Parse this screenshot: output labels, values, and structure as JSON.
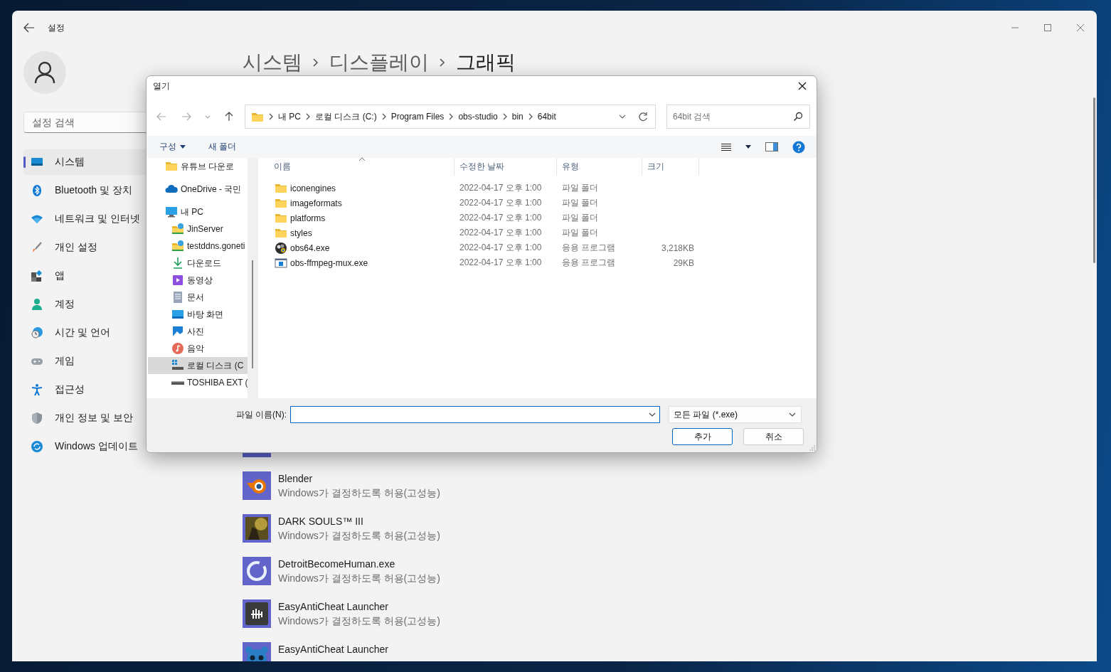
{
  "settings": {
    "title": "설정",
    "search": {
      "placeholder": "설정 검색"
    },
    "nav": [
      {
        "label": "시스템",
        "kind": "system",
        "selected": true
      },
      {
        "label": "Bluetooth 및 장치",
        "kind": "bluetooth",
        "selected": false
      },
      {
        "label": "네트워크 및 인터넷",
        "kind": "network",
        "selected": false
      },
      {
        "label": "개인 설정",
        "kind": "brush",
        "selected": false
      },
      {
        "label": "앱",
        "kind": "apps",
        "selected": false
      },
      {
        "label": "계정",
        "kind": "account",
        "selected": false
      },
      {
        "label": "시간 및 언어",
        "kind": "time",
        "selected": false
      },
      {
        "label": "게임",
        "kind": "game",
        "selected": false
      },
      {
        "label": "접근성",
        "kind": "accessibility",
        "selected": false
      },
      {
        "label": "개인 정보 및 보안",
        "kind": "shield",
        "selected": false
      },
      {
        "label": "Windows 업데이트",
        "kind": "update",
        "selected": false
      }
    ],
    "breadcrumb": [
      "시스템",
      "디스플레이",
      "그래픽"
    ],
    "apps": [
      {
        "kind": "generic"
      },
      {
        "kind": "blender",
        "name": "Blender",
        "subtitle": "Windows가 결정하도록 허용(고성능)"
      },
      {
        "kind": "game-art",
        "name": "DARK SOULS™ III",
        "subtitle": "Windows가 결정하도록 허용(고성능)"
      },
      {
        "kind": "ring",
        "name": "DetroitBecomeHuman.exe",
        "subtitle": "Windows가 결정하도록 허용(고성능)"
      },
      {
        "kind": "marks",
        "name": "EasyAntiCheat Launcher",
        "subtitle": "Windows가 결정하도록 허용(고성능)"
      },
      {
        "kind": "mascot",
        "name": "EasyAntiCheat Launcher"
      }
    ]
  },
  "dialog": {
    "title": "열기",
    "path": [
      "내 PC",
      "로컬 디스크 (C:)",
      "Program Files",
      "obs-studio",
      "bin",
      "64bit"
    ],
    "search": {
      "placeholder": "64bit 검색"
    },
    "commands": [
      "구성",
      "새 폴더"
    ],
    "nav_pane": [
      {
        "label": "유튜브 다운로",
        "kind": "folder",
        "selected": false
      },
      {
        "label": "OneDrive - 국민",
        "kind": "cloud",
        "selected": false
      },
      {
        "label": "내 PC",
        "kind": "pc",
        "selected": false,
        "children": [
          {
            "label": "JinServer",
            "kind": "netfolder",
            "selected": false
          },
          {
            "label": "testddns.goneti",
            "kind": "netfolder",
            "selected": false
          },
          {
            "label": "다운로드",
            "kind": "download",
            "selected": false
          },
          {
            "label": "동영상",
            "kind": "video",
            "selected": false
          },
          {
            "label": "문서",
            "kind": "doc",
            "selected": false
          },
          {
            "label": "바탕 화면",
            "kind": "desktop",
            "selected": false
          },
          {
            "label": "사진",
            "kind": "photo",
            "selected": false
          },
          {
            "label": "음악",
            "kind": "music",
            "selected": false
          },
          {
            "label": "로컬 디스크 (C",
            "kind": "drive-c",
            "selected": true
          },
          {
            "label": "TOSHIBA EXT (",
            "kind": "drive",
            "selected": false
          }
        ]
      }
    ],
    "columns": [
      "이름",
      "수정한 날짜",
      "유형",
      "크기"
    ],
    "files": [
      {
        "name": "iconengines",
        "date": "2022-04-17 오후 1:00",
        "type": "파일 폴더",
        "kind": "folder"
      },
      {
        "name": "imageformats",
        "date": "2022-04-17 오후 1:00",
        "type": "파일 폴더",
        "kind": "folder"
      },
      {
        "name": "platforms",
        "date": "2022-04-17 오후 1:00",
        "type": "파일 폴더",
        "kind": "folder"
      },
      {
        "name": "styles",
        "date": "2022-04-17 오후 1:00",
        "type": "파일 폴더",
        "kind": "folder"
      },
      {
        "name": "obs64.exe",
        "date": "2022-04-17 오후 1:00",
        "type": "응용 프로그램",
        "size": "3,218KB",
        "kind": "obs"
      },
      {
        "name": "obs-ffmpeg-mux.exe",
        "date": "2022-04-17 오후 1:00",
        "type": "응용 프로그램",
        "size": "29KB",
        "kind": "window"
      }
    ],
    "file_name_label": "파일 이름(N):",
    "filter": "모든 파일 (*.exe)",
    "buttons": [
      {
        "label": "추가",
        "primary": true
      },
      {
        "label": "취소",
        "primary": false
      }
    ]
  }
}
